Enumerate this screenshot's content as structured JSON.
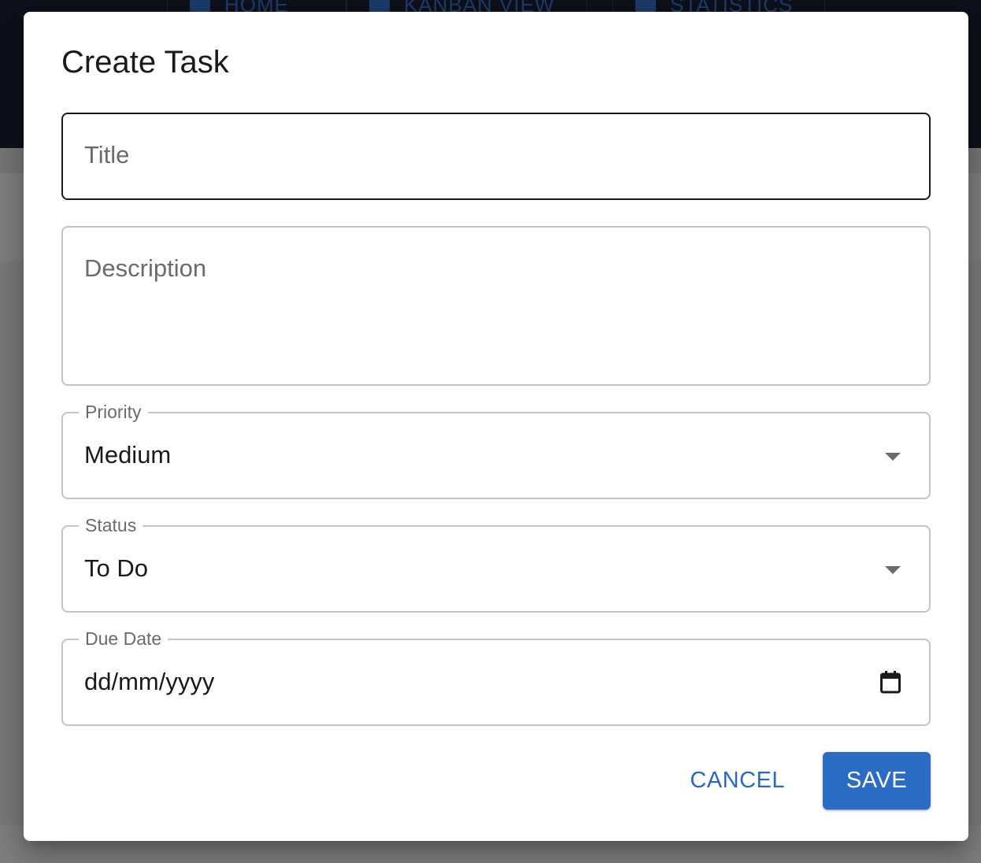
{
  "background": {
    "nav": [
      {
        "label": "HOME",
        "icon": "home-icon"
      },
      {
        "label": "KANBAN VIEW",
        "icon": "kanban-icon"
      },
      {
        "label": "STATISTICS",
        "icon": "bar-chart-icon"
      }
    ]
  },
  "dialog": {
    "title": "Create Task",
    "title_field": {
      "placeholder": "Title",
      "value": ""
    },
    "description_field": {
      "placeholder": "Description",
      "value": ""
    },
    "priority_field": {
      "label": "Priority",
      "value": "Medium"
    },
    "status_field": {
      "label": "Status",
      "value": "To Do"
    },
    "due_date_field": {
      "label": "Due Date",
      "value": "dd/mm/yyyy",
      "icon": "calendar-icon"
    },
    "actions": {
      "cancel_label": "CANCEL",
      "save_label": "SAVE"
    }
  },
  "colors": {
    "primary": "#2b6cc6",
    "app_bar": "#1c2336",
    "scrim": "rgba(0,0,0,0.5)"
  }
}
